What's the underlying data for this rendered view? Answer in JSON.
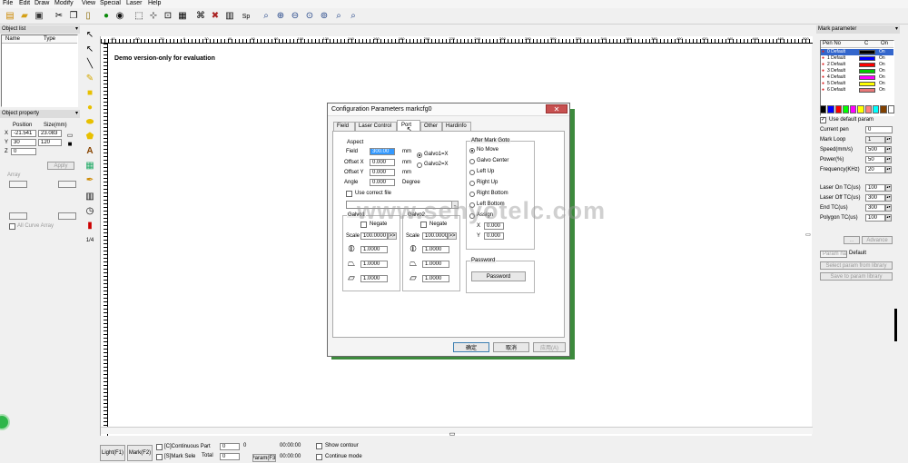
{
  "menu": [
    "File",
    "Edit",
    "Draw",
    "Modify",
    "View",
    "Special",
    "Laser",
    "Help"
  ],
  "toolbar": {
    "icons": [
      "new-file-icon",
      "open-file-icon",
      "save-icon",
      "cut-icon",
      "copy-icon",
      "paste-icon",
      "go-icon",
      "stop-icon",
      "select-icon",
      "node-icon",
      "transform-icon",
      "hatch-icon",
      "tools-icon",
      "properties-icon",
      "spin-icon",
      "zoom-icon",
      "zoom-in-icon",
      "zoom-out-icon",
      "zoom-all-icon",
      "zoom-fit-icon",
      "zoom-prev-icon",
      "zoom-select-icon"
    ]
  },
  "object_list": {
    "title": "Object list",
    "col_name": "Name",
    "col_type": "Type"
  },
  "object_property": {
    "title": "Object property",
    "position_label": "Position",
    "size_label": "Size(mm)",
    "x_label": "X",
    "y_label": "Y",
    "z_label": "Z",
    "x_pos": "-21.541",
    "x_size": "23.083",
    "y_pos": "30",
    "y_size": "120",
    "z_pos": "0",
    "apply_label": "Apply",
    "array_label": "Array",
    "all_curve_label": "All Curve Array"
  },
  "canvas": {
    "watermark": "Demo version-only for evaluation",
    "site_watermark": "www.senyotelc.com",
    "ruler_labels": [
      "-40",
      "-60",
      "-20",
      "0",
      "20",
      "40",
      "60",
      "80",
      "100",
      "120",
      "140",
      "160",
      "180",
      "200",
      "220",
      "240",
      "260",
      "280",
      "300",
      "320",
      "340",
      "360",
      "380",
      "400",
      "420",
      "440",
      "460",
      "480",
      "500"
    ]
  },
  "dialog": {
    "title": "Configuration Parameters markcfg0",
    "tabs": [
      "Field",
      "Laser Control",
      "Port",
      "Other",
      "Hardinfo"
    ],
    "aspect": {
      "title": "Aspect",
      "field_label": "Field",
      "field_value": "300.00",
      "field_unit": "mm",
      "offset_x_label": "Offset X",
      "offset_x_value": "0.000",
      "offset_x_unit": "mm",
      "offset_y_label": "Offset Y",
      "offset_y_value": "0.000",
      "offset_y_unit": "mm",
      "angle_label": "Angle",
      "angle_value": "0.000",
      "angle_unit": "Degree",
      "galvo1_label": "Galvo1=X",
      "galvo2_label": "Galvo2=X",
      "use_correct_file": "Use correct file",
      "galvo1_group": "Galvo1",
      "galvo2_group": "Galvo2",
      "negate1": "Negate",
      "negate2": "Negate",
      "scale_label": "Scale",
      "scale1_value": "100.0000",
      "scale2_value": "100.0000",
      "coef1_a": "1.0000",
      "coef1_b": "1.0000",
      "coef1_c": "1.0000",
      "coef2_a": "1.0000",
      "coef2_b": "1.0000",
      "coef2_c": "1.0000"
    },
    "after_mark": {
      "title": "After Mark Goto",
      "options": [
        "No Move",
        "Galvo Center",
        "Left Up",
        "Right Up",
        "Right Bottom",
        "Left Bottom",
        "Assign"
      ],
      "x_label": "X",
      "x_value": "0.000",
      "y_label": "Y",
      "y_value": "0.000"
    },
    "password": {
      "title": "Password",
      "button": "Password"
    },
    "ok_label": "确定",
    "cancel_label": "取消",
    "apply_label": "应用(A)"
  },
  "mark_parameter": {
    "title": "Mark parameter",
    "col_pen": "Pen No",
    "col_color": "C",
    "col_on": "On",
    "pens": [
      {
        "name": "0 Default",
        "color": "#000000",
        "on": "On"
      },
      {
        "name": "1 Default",
        "color": "#0000ff",
        "on": "On"
      },
      {
        "name": "2 Default",
        "color": "#ff0000",
        "on": "On"
      },
      {
        "name": "3 Default",
        "color": "#00cc00",
        "on": "On"
      },
      {
        "name": "4 Default",
        "color": "#ff00ff",
        "on": "On"
      },
      {
        "name": "5 Default",
        "color": "#ffff00",
        "on": "On"
      },
      {
        "name": "6 Default",
        "color": "#e87878",
        "on": "On"
      }
    ],
    "palette": [
      "#000000",
      "#0000ff",
      "#ff0000",
      "#00ff00",
      "#ff00ff",
      "#ffff00",
      "#ff8080",
      "#00ffff",
      "#804000",
      "#ffffff"
    ],
    "use_default": "Use default param",
    "current_pen_label": "Current pen",
    "current_pen": "0",
    "mark_loop_label": "Mark Loop",
    "mark_loop": "1",
    "speed_label": "Speed(mm/s)",
    "speed": "500",
    "power_label": "Power(%)",
    "power": "50",
    "freq_label": "Frequency(KHz)",
    "freq": "20",
    "laser_on_label": "Laser On TC(us)",
    "laser_on": "100",
    "laser_off_label": "Laser Off TC(us)",
    "laser_off": "300",
    "end_tc_label": "End TC(us)",
    "end_tc": "300",
    "polygon_tc_label": "Polygon TC(us)",
    "polygon_tc": "100",
    "btn_more": "...",
    "btn_advance": "Advance",
    "param_name_label": "Param name",
    "param_name": "Default",
    "btn_select_param": "Select param from library",
    "btn_save_param": "Save to param library"
  },
  "bottom": {
    "light_btn": "Light(F1)",
    "mark_btn": "Mark(F2)",
    "continuous": "[C]Continuous Part",
    "mark_sele": "[S]Mark Sele",
    "part_value": "0",
    "total_label": "Total",
    "total_value": "0",
    "zero_value": "0",
    "time1": "00:00:00",
    "time2": "00:00:00",
    "param_btn": "Param(F3)",
    "show_contour": "Show contour",
    "continue_mode": "Continue mode"
  }
}
